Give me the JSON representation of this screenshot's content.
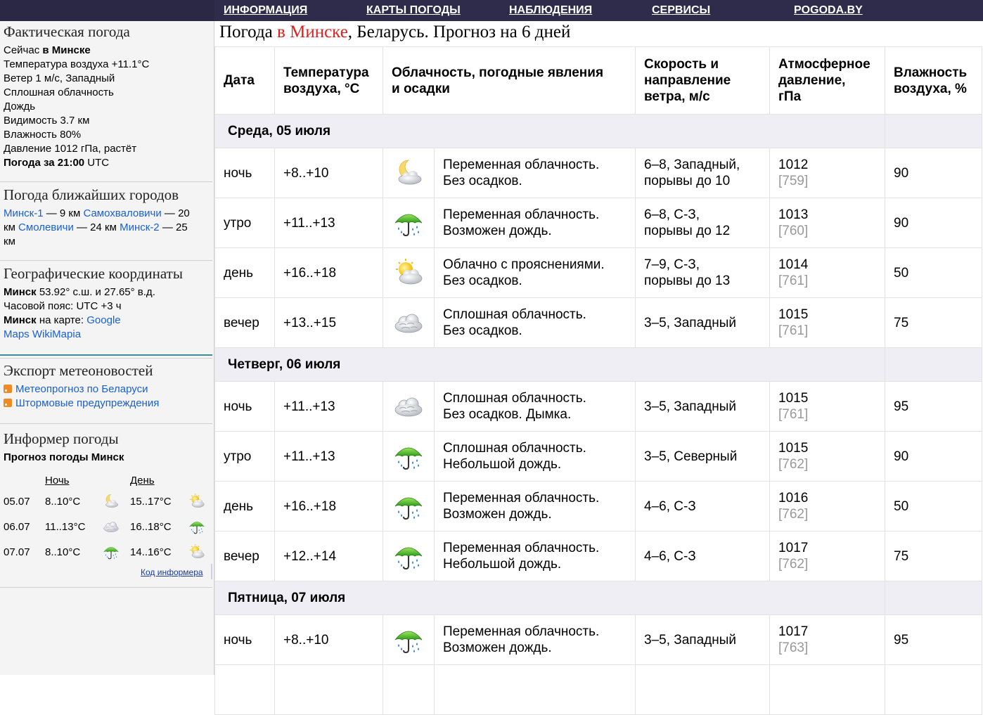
{
  "nav": {
    "items": [
      "ИНФОРМАЦИЯ",
      "КАРТЫ ПОГОДЫ",
      "НАБЛЮДЕНИЯ",
      "СЕРВИСЫ",
      "POGODA.BY"
    ]
  },
  "actual": {
    "heading": "Фактическая погода",
    "now_prefix": "Сейчас",
    "now_city": "в Минске",
    "temp": "Температура воздуха +11.1°C",
    "wind": "Ветер 1 м/с, Западный",
    "clouds": "Сплошная облачность",
    "rain": "Дождь",
    "visibility": "Видимость 3.7 км",
    "humidity": "Влажность 80%",
    "pressure": "Давление 1012 гПа, растёт",
    "time_label": "Погода за 21:00",
    "time_tz": "UTC"
  },
  "nearby": {
    "heading": "Погода ближайших городов",
    "c1": "Минск-1",
    "d1": "— 9 км",
    "c2": "Самохваловичи",
    "d2": "— 20",
    "d2b": "км",
    "c3": "Смолевичи",
    "d3": "— 24 км",
    "c4": "Минск-2",
    "d4": "— 25",
    "d4b": "км"
  },
  "geo": {
    "heading": "Географические координаты",
    "city": "Минск",
    "coords": "53.92° с.ш. и 27.65° в.д.",
    "tz": "Часовой пояс: UTC +3 ч",
    "map_prefix": "на карте:",
    "link1a": "Google",
    "link1b": "Maps",
    "link2": "WikiMapia"
  },
  "export": {
    "heading": "Экспорт метеоновостей",
    "items": [
      "Метеопрогноз по Беларуси",
      "Штормовые предупреждения"
    ]
  },
  "informer": {
    "heading": "Информер погоды",
    "subtitle": "Прогноз погоды Минск",
    "night_label": "Ночь",
    "day_label": "День",
    "rows": [
      {
        "date": "05.07",
        "night": "8..10°C",
        "day": "15..17°C",
        "night_icon": "moon-cloud-icon",
        "day_icon": "sun-cloud-icon"
      },
      {
        "date": "06.07",
        "night": "11..13°C",
        "day": "16..18°C",
        "night_icon": "cloud-icon",
        "day_icon": "umbrella-rain-icon"
      },
      {
        "date": "07.07",
        "night": "8..10°C",
        "day": "14..16°C",
        "night_icon": "umbrella-rain-icon",
        "day_icon": "sun-cloud-icon"
      }
    ],
    "code_link": "Код информера"
  },
  "main": {
    "title_prefix": "Погода",
    "title_city": "в Минске",
    "title_suffix": ", Беларусь. Прогноз на 6 дней",
    "headers": {
      "date": "Дата",
      "temp_1": "Температура",
      "temp_2": "воздуха, °С",
      "clouds_1": "Облачность, погодные явления",
      "clouds_2": "и осадки",
      "wind_1": "Скорость и",
      "wind_2": "направление",
      "wind_3": "ветра, м/с",
      "press_1": "Атмосферное",
      "press_2": "давление,",
      "press_3": "гПа",
      "hum_1": "Влажность",
      "hum_2": "воздуха, %"
    },
    "days": [
      {
        "label": "Среда, 05 июля",
        "rows": [
          {
            "period": "ночь",
            "temp": "+8..+10",
            "icon": "moon-cloud-icon",
            "desc1": "Переменная облачность.",
            "desc2": "Без осадков.",
            "wind1": "6–8, Западный,",
            "wind2": "порывы до 10",
            "press": "1012",
            "mm": "[759]",
            "hum": "90"
          },
          {
            "period": "утро",
            "temp": "+11..+13",
            "icon": "umbrella-rain-icon",
            "desc1": "Переменная облачность.",
            "desc2": "Возможен дождь.",
            "wind1": "6–8, С-З,",
            "wind2": "порывы до 12",
            "press": "1013",
            "mm": "[760]",
            "hum": "90"
          },
          {
            "period": "день",
            "temp": "+16..+18",
            "icon": "sun-cloud-icon",
            "desc1": "Облачно с прояснениями.",
            "desc2": "Без осадков.",
            "wind1": "7–9, С-З,",
            "wind2": "порывы до 13",
            "press": "1014",
            "mm": "[761]",
            "hum": "50"
          },
          {
            "period": "вечер",
            "temp": "+13..+15",
            "icon": "cloud-icon",
            "desc1": "Сплошная облачность.",
            "desc2": "Без осадков.",
            "wind1": "3–5, Западный",
            "wind2": "",
            "press": "1015",
            "mm": "[761]",
            "hum": "75"
          }
        ]
      },
      {
        "label": "Четверг, 06 июля",
        "rows": [
          {
            "period": "ночь",
            "temp": "+11..+13",
            "icon": "cloud-icon",
            "desc1": "Сплошная облачность.",
            "desc2": "Без осадков. Дымка.",
            "wind1": "3–5, Западный",
            "wind2": "",
            "press": "1015",
            "mm": "[761]",
            "hum": "95"
          },
          {
            "period": "утро",
            "temp": "+11..+13",
            "icon": "umbrella-rain-icon",
            "desc1": "Сплошная облачность.",
            "desc2": "Небольшой дождь.",
            "wind1": "3–5, Северный",
            "wind2": "",
            "press": "1015",
            "mm": "[762]",
            "hum": "90"
          },
          {
            "period": "день",
            "temp": "+16..+18",
            "icon": "umbrella-rain-icon",
            "desc1": "Переменная облачность.",
            "desc2": "Возможен дождь.",
            "wind1": "4–6, С-З",
            "wind2": "",
            "press": "1016",
            "mm": "[762]",
            "hum": "50"
          },
          {
            "period": "вечер",
            "temp": "+12..+14",
            "icon": "umbrella-rain-icon",
            "desc1": "Переменная облачность.",
            "desc2": "Небольшой дождь.",
            "wind1": "4–6, С-З",
            "wind2": "",
            "press": "1017",
            "mm": "[762]",
            "hum": "75"
          }
        ]
      },
      {
        "label": "Пятница, 07 июля",
        "rows": [
          {
            "period": "ночь",
            "temp": "+8..+10",
            "icon": "umbrella-rain-icon",
            "desc1": "Переменная облачность.",
            "desc2": "Возможен дождь.",
            "wind1": "3–5, Западный",
            "wind2": "",
            "press": "1017",
            "mm": "[763]",
            "hum": "95"
          }
        ]
      }
    ]
  }
}
